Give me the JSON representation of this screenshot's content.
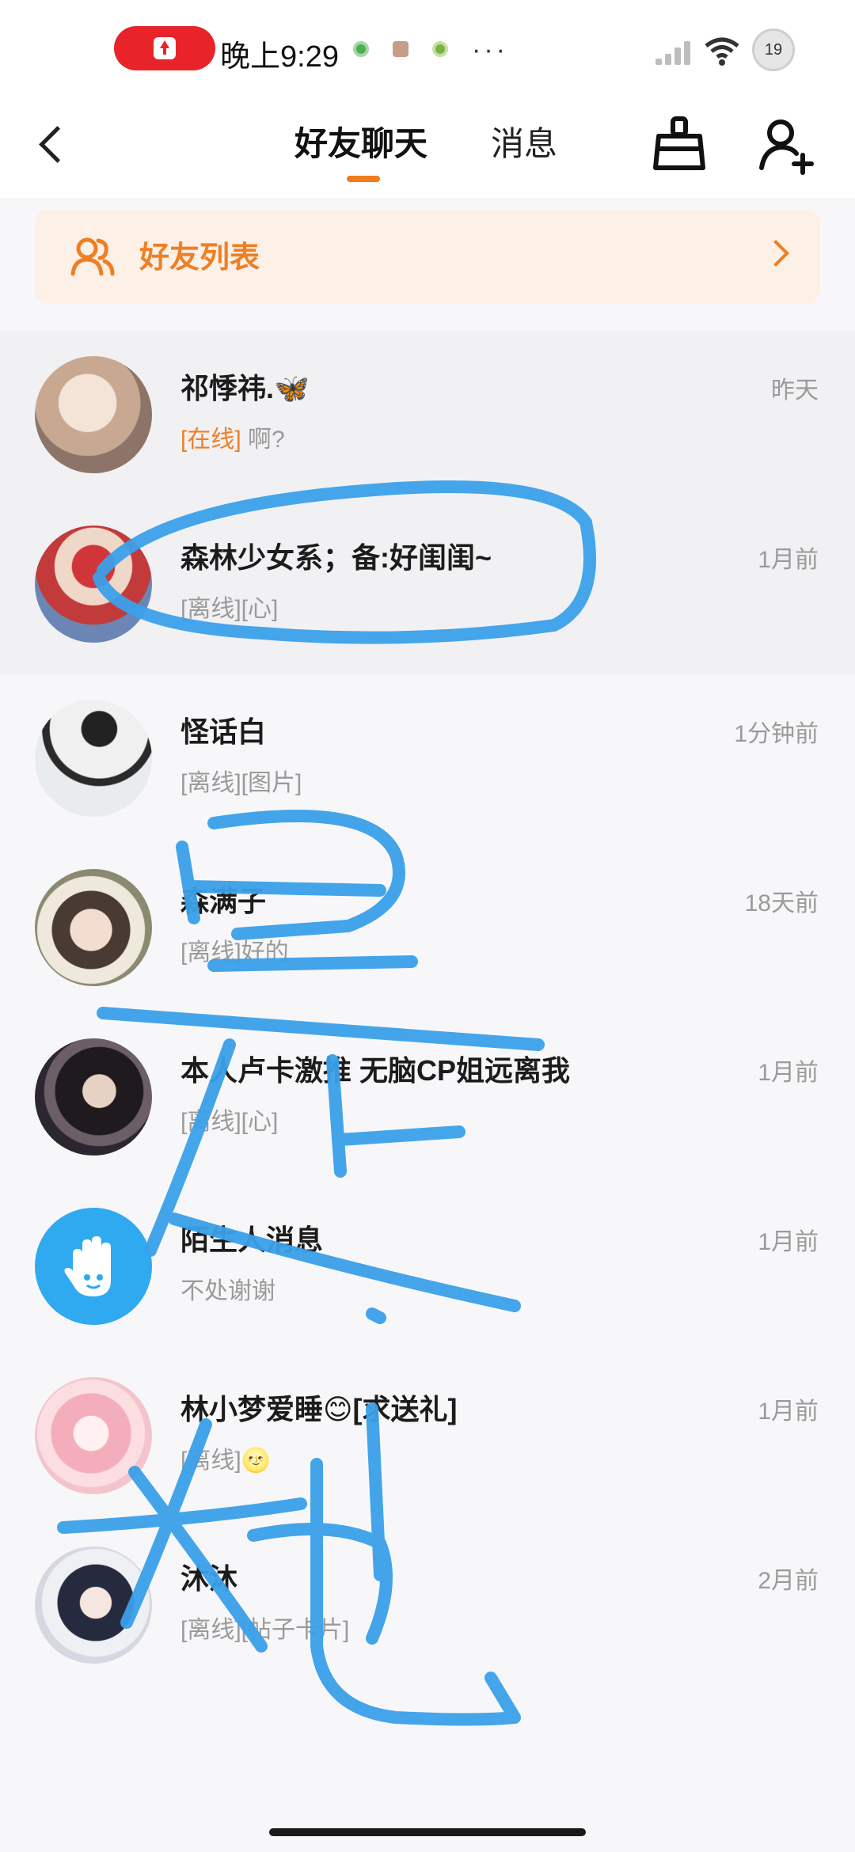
{
  "status_bar": {
    "time": "晚上9:29",
    "more": "···",
    "battery": "19"
  },
  "header": {
    "tab_friends": "好友聊天",
    "tab_messages": "消息",
    "icons": {
      "back": "back-arrow-icon",
      "clean": "broom-icon",
      "add_friend": "add-friend-icon"
    },
    "accent_color": "#f07c1c"
  },
  "banner": {
    "label": "好友列表",
    "icon": "friends-icon"
  },
  "chats": [
    {
      "name": "祁悸祎.🦋",
      "status": "[在线]",
      "preview": " 啊?",
      "time": "昨天",
      "pinned": true,
      "avatar_color": "#d9c8b8"
    },
    {
      "name": "森林少女系；备:好闺闺~",
      "status": "[离线]",
      "preview": "[心]",
      "time": "1月前",
      "pinned": true,
      "avatar_color": "#6b86b4"
    },
    {
      "name": "怪话白",
      "status": "[离线]",
      "preview": "[图片]",
      "time": "1分钟前",
      "pinned": false,
      "avatar_color": "#dfe2e6"
    },
    {
      "name": "森满子",
      "status": "[离线]",
      "preview": "好的",
      "time": "18天前",
      "pinned": false,
      "avatar_color": "#d8cbb8"
    },
    {
      "name": "本人卢卡激推 无脑CP姐远离我",
      "status": "[离线]",
      "preview": "[心]",
      "time": "1月前",
      "pinned": false,
      "avatar_color": "#3a3036"
    },
    {
      "name": "陌生人消息",
      "status": "",
      "preview": "不处谢谢",
      "time": "1月前",
      "pinned": false,
      "avatar_color": "#2fa9ef"
    },
    {
      "name": "林小梦爱睡😊[求送礼]",
      "status": "[离线]",
      "preview": "🌝",
      "time": "1月前",
      "pinned": false,
      "avatar_color": "#f3c4cc"
    },
    {
      "name": "沐沐",
      "status": "[离线]",
      "preview": "[帖子卡片]",
      "time": "2月前",
      "pinned": false,
      "avatar_color": "#d5d8e0"
    }
  ],
  "annotation_color": "#3ba0ea"
}
